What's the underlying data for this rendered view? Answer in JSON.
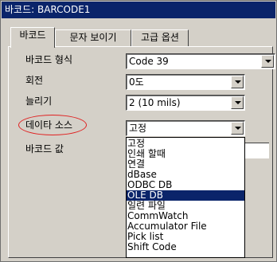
{
  "window": {
    "title": "바코드: BARCODE1"
  },
  "tabs": [
    {
      "label": "바코드",
      "active": true
    },
    {
      "label": "문자 보이기",
      "active": false
    },
    {
      "label": "고급 옵션",
      "active": false
    }
  ],
  "fields": {
    "barcode_type": {
      "label": "바코드 형식",
      "value": "Code 39"
    },
    "rotation": {
      "label": "회전",
      "value": "0도"
    },
    "stretch": {
      "label": "늘리기",
      "value": "2  (10 mils)"
    },
    "data_source": {
      "label": "데이타 소스",
      "value": "고정",
      "highlight_color": "#e02020"
    },
    "barcode_value": {
      "label": "바코드 값",
      "value": ""
    }
  },
  "data_source_options": {
    "items": [
      "고정",
      "인쇄 할때",
      "연결",
      "dBase",
      "ODBC DB",
      "OLE DB",
      "일련 파일",
      "CommWatch",
      "Accumulator File",
      "Pick list",
      "Shift Code"
    ],
    "highlighted": "OLE DB"
  },
  "colors": {
    "title_bar": "#0a246a",
    "selection": "#0a246a",
    "dialog_face": "#d4d0c8"
  }
}
